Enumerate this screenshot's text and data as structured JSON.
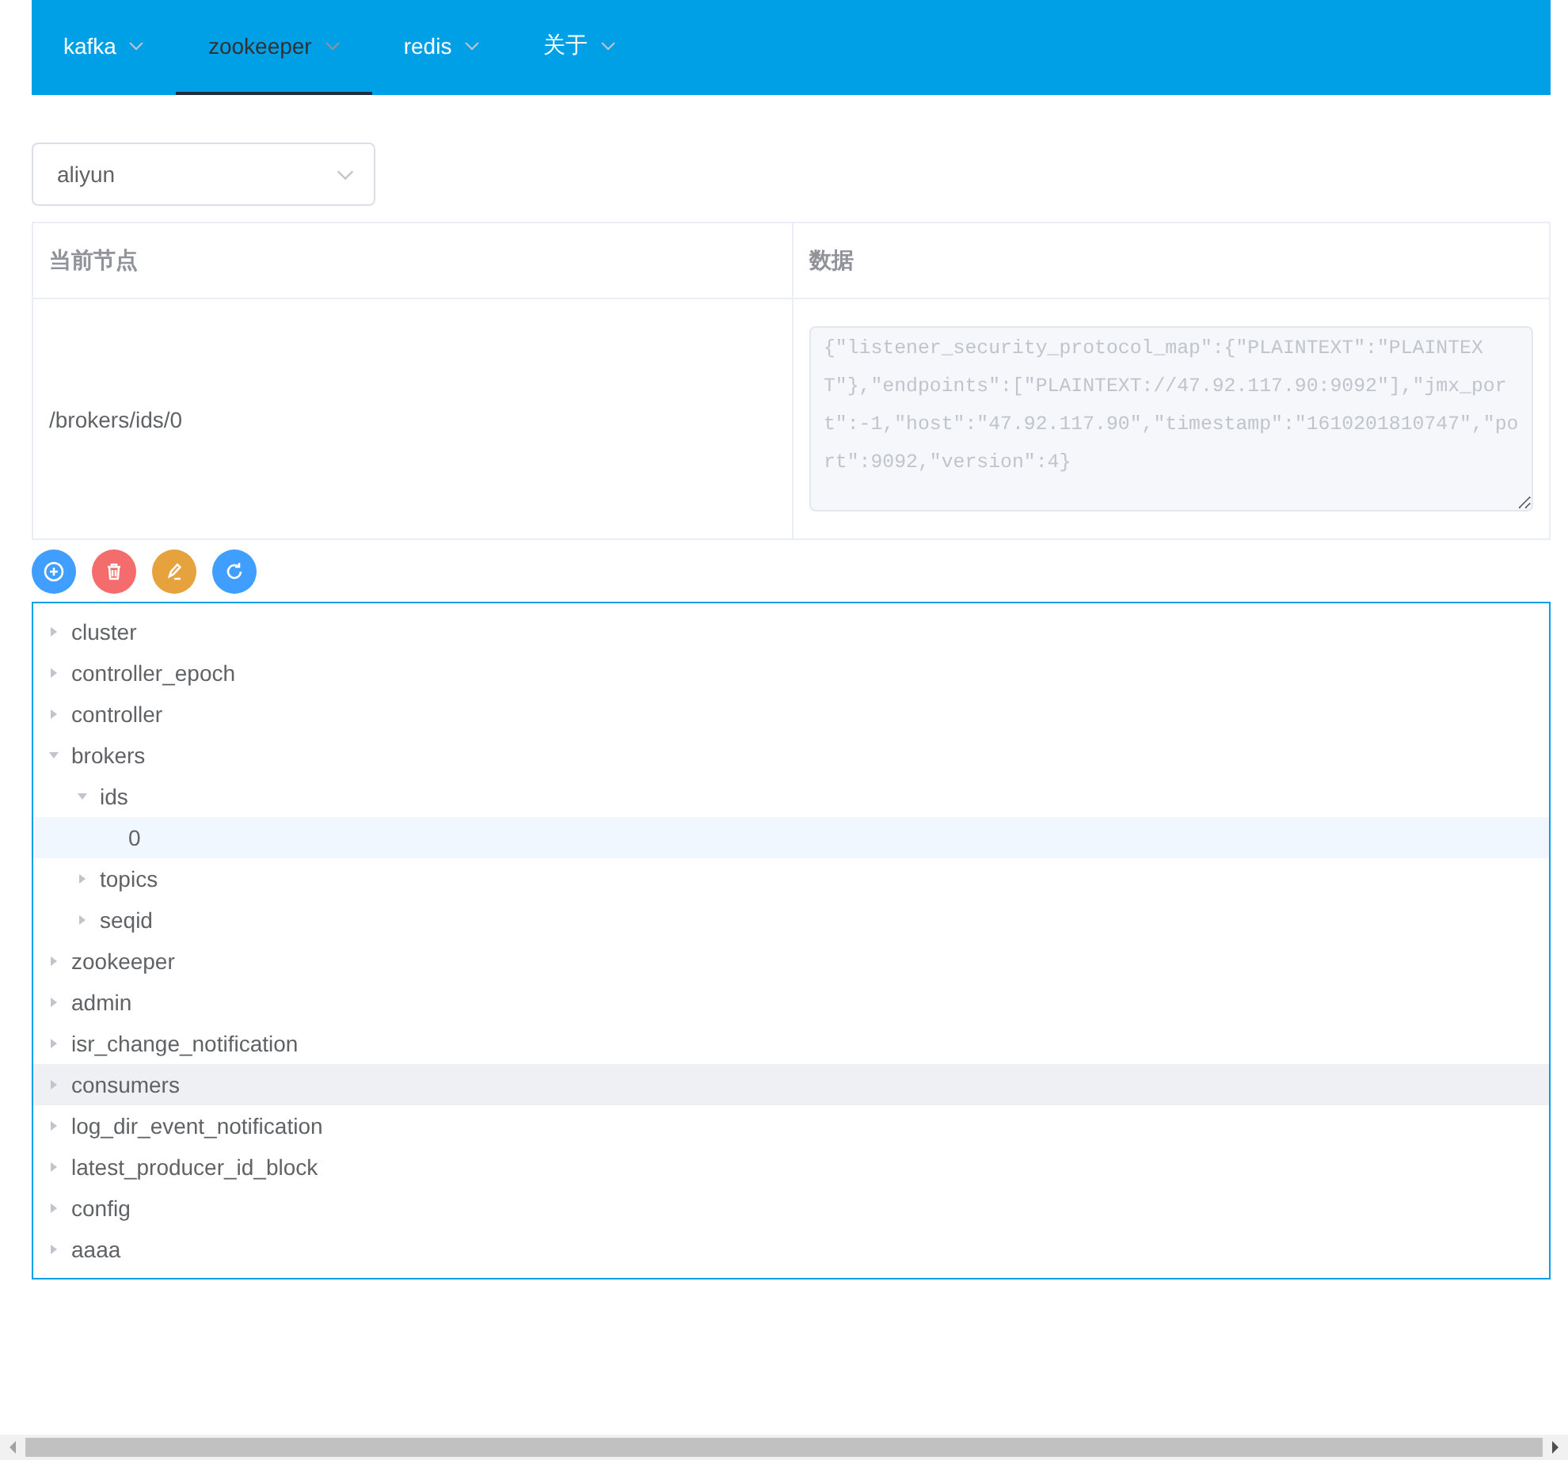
{
  "nav": {
    "items": [
      {
        "label": "kafka",
        "selected": false
      },
      {
        "label": "zookeeper",
        "selected": true
      },
      {
        "label": "redis",
        "selected": false
      },
      {
        "label": "关于",
        "selected": false
      }
    ]
  },
  "cluster_select": {
    "value": "aliyun"
  },
  "node_table": {
    "columns": [
      "当前节点",
      "数据"
    ],
    "path": "/brokers/ids/0",
    "data": {
      "value": "{\"listener_security_protocol_map\":{\"PLAINTEXT\":\"PLAINTEXT\"},\"endpoints\":[\"PLAINTEXT://47.92.117.90:9092\"],\"jmx_port\":-1,\"host\":\"47.92.117.90\",\"timestamp\":\"1610201810747\",\"port\":9092,\"version\":4}",
      "disabled": true
    }
  },
  "actions": [
    {
      "kind": "add",
      "color": "#409eff"
    },
    {
      "kind": "delete",
      "color": "#f56c6c"
    },
    {
      "kind": "edit",
      "color": "#e6a23c"
    },
    {
      "kind": "refresh",
      "color": "#409eff"
    }
  ],
  "tree": [
    {
      "label": "cluster",
      "expanded": false,
      "selected": false,
      "hovered": false
    },
    {
      "label": "controller_epoch",
      "expanded": false,
      "selected": false,
      "hovered": false
    },
    {
      "label": "controller",
      "expanded": false,
      "selected": false,
      "hovered": false
    },
    {
      "label": "brokers",
      "expanded": true,
      "selected": false,
      "hovered": false,
      "children": [
        {
          "label": "ids",
          "expanded": true,
          "selected": false,
          "hovered": false,
          "children": [
            {
              "label": "0",
              "leaf": true,
              "selected": true,
              "hovered": false
            }
          ]
        },
        {
          "label": "topics",
          "expanded": false,
          "selected": false,
          "hovered": false
        },
        {
          "label": "seqid",
          "expanded": false,
          "selected": false,
          "hovered": false
        }
      ]
    },
    {
      "label": "zookeeper",
      "expanded": false,
      "selected": false,
      "hovered": false
    },
    {
      "label": "admin",
      "expanded": false,
      "selected": false,
      "hovered": false
    },
    {
      "label": "isr_change_notification",
      "expanded": false,
      "selected": false,
      "hovered": false
    },
    {
      "label": "consumers",
      "expanded": false,
      "selected": false,
      "hovered": true
    },
    {
      "label": "log_dir_event_notification",
      "expanded": false,
      "selected": false,
      "hovered": false
    },
    {
      "label": "latest_producer_id_block",
      "expanded": false,
      "selected": false,
      "hovered": false
    },
    {
      "label": "config",
      "expanded": false,
      "selected": false,
      "hovered": false
    },
    {
      "label": "aaaa",
      "expanded": false,
      "selected": false,
      "hovered": false
    }
  ]
}
